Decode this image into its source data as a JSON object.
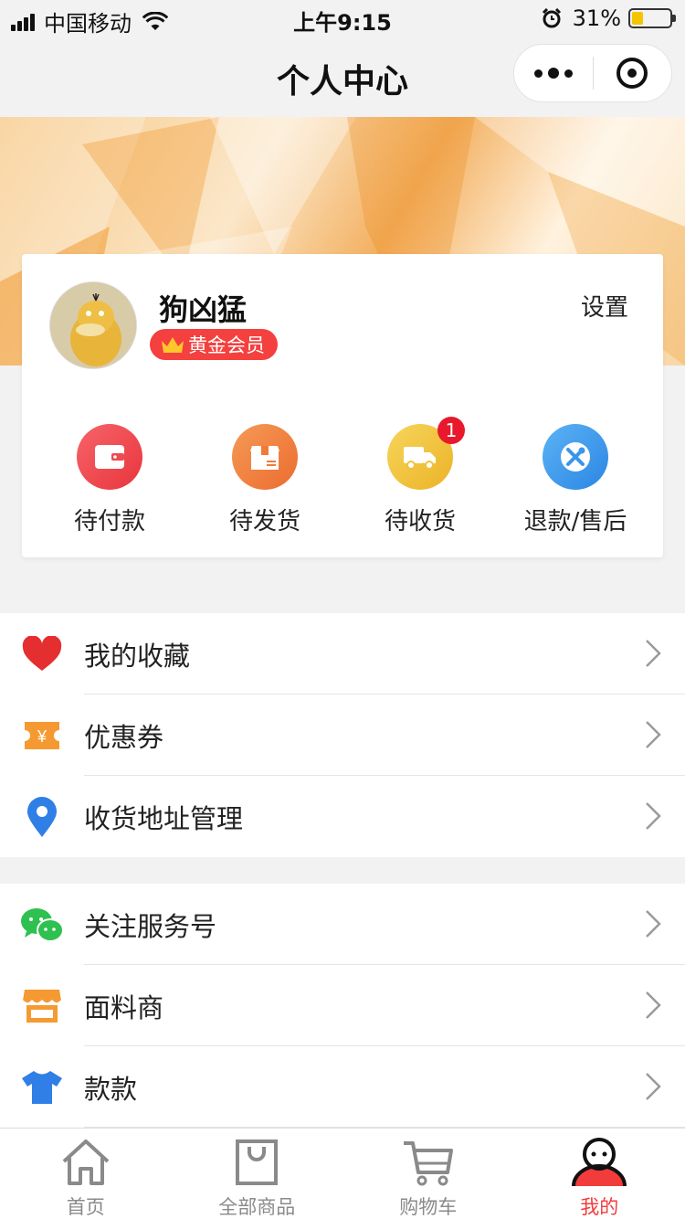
{
  "status_bar": {
    "carrier": "中国移动",
    "time": "上午9:15",
    "battery_text": "31%",
    "battery_level": 0.31
  },
  "nav": {
    "title": "个人中心"
  },
  "profile": {
    "name": "狗凶猛",
    "member_level": "黄金会员",
    "settings_label": "设置"
  },
  "orders": [
    {
      "label": "待付款",
      "icon": "wallet-icon",
      "color": "#ef4a4f"
    },
    {
      "label": "待发货",
      "icon": "package-icon",
      "color": "#f07a3a"
    },
    {
      "label": "待收货",
      "icon": "truck-icon",
      "color": "#f0c23a",
      "badge": "1"
    },
    {
      "label": "退款/售后",
      "icon": "tools-icon",
      "color": "#3a96ea"
    }
  ],
  "menu_group_1": [
    {
      "label": "我的收藏",
      "icon": "heart-icon"
    },
    {
      "label": "优惠券",
      "icon": "coupon-icon"
    },
    {
      "label": "收货地址管理",
      "icon": "location-pin-icon"
    }
  ],
  "menu_group_2": [
    {
      "label": "关注服务号",
      "icon": "wechat-icon"
    },
    {
      "label": "面料商",
      "icon": "store-icon"
    },
    {
      "label": "款款",
      "icon": "tshirt-icon"
    }
  ],
  "tab_bar": [
    {
      "label": "首页",
      "icon": "home-icon"
    },
    {
      "label": "全部商品",
      "icon": "bag-icon"
    },
    {
      "label": "购物车",
      "icon": "cart-icon"
    },
    {
      "label": "我的",
      "icon": "user-icon",
      "active": true
    }
  ],
  "colors": {
    "accent_red": "#f23c3c",
    "badge_red": "#e8192c",
    "banner_orange": "#f3b060"
  }
}
